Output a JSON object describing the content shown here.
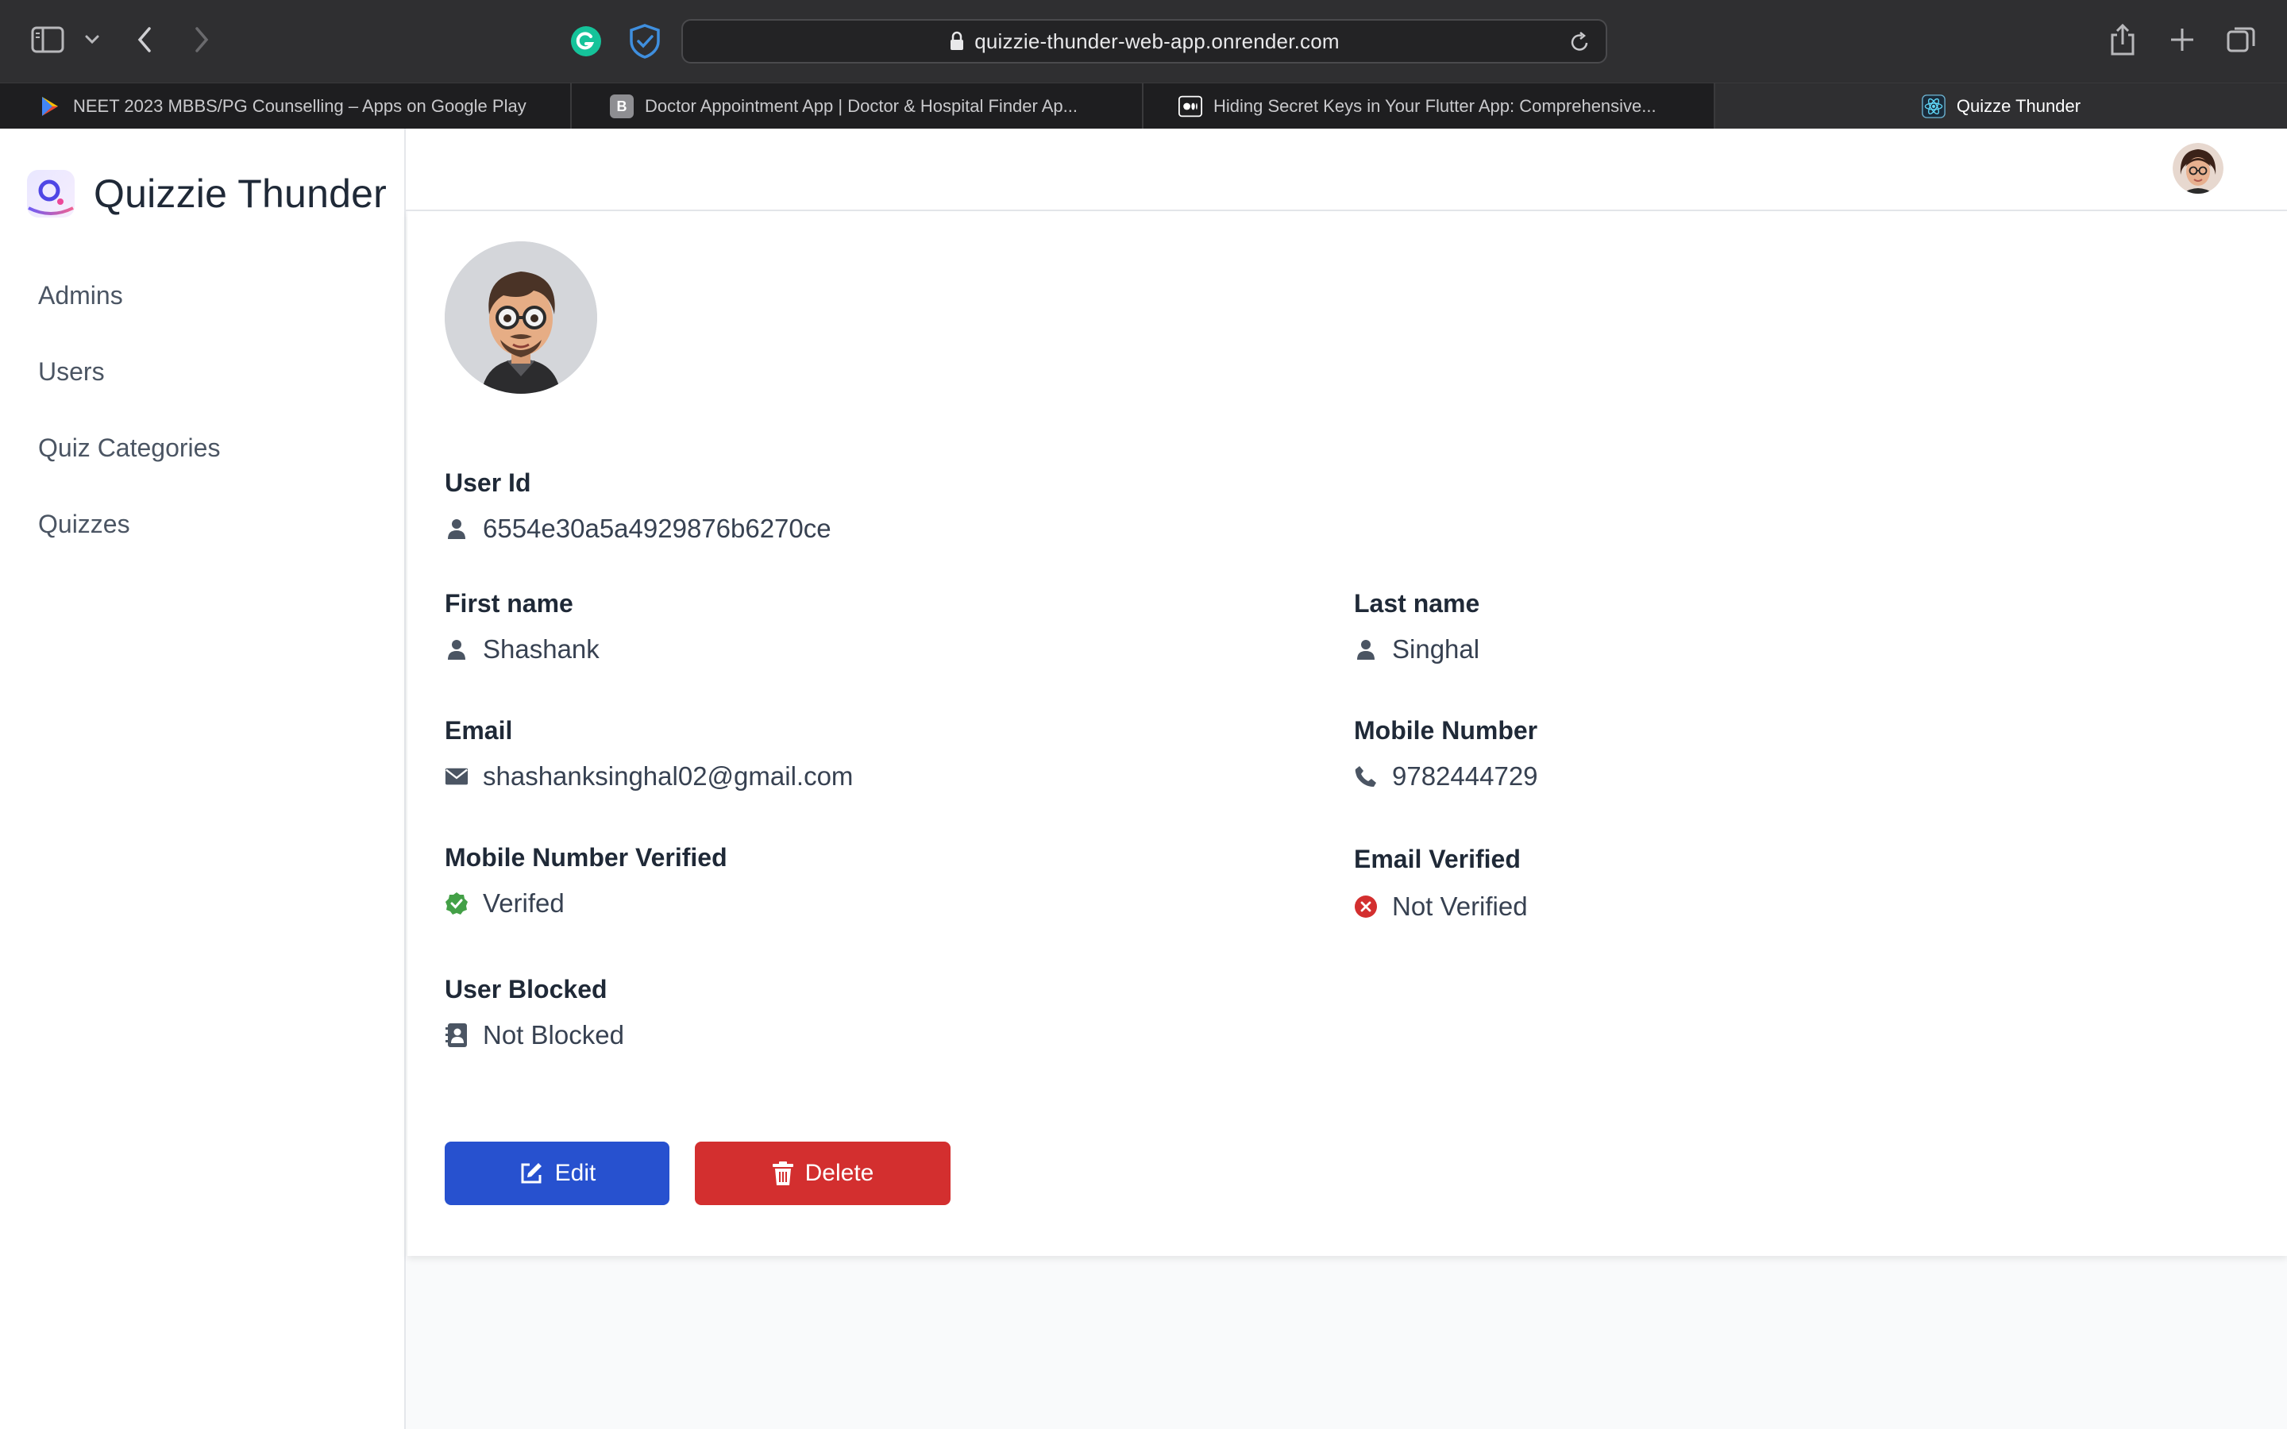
{
  "browser": {
    "url": "quizzie-thunder-web-app.onrender.com",
    "tabs": [
      {
        "title": "NEET 2023 MBBS/PG Counselling – Apps on Google Play",
        "icon": "google-play-icon"
      },
      {
        "title": "Doctor Appointment App | Doctor & Hospital Finder Ap...",
        "icon": "b-letter-icon",
        "fav_text": "B"
      },
      {
        "title": "Hiding Secret Keys in Your Flutter App: Comprehensive...",
        "icon": "medium-icon"
      },
      {
        "title": "Quizze Thunder",
        "icon": "react-icon",
        "active": true
      }
    ]
  },
  "app": {
    "brand": "Quizzie Thunder",
    "nav": [
      "Admins",
      "Users",
      "Quiz Categories",
      "Quizzes"
    ]
  },
  "user": {
    "user_id_label": "User Id",
    "user_id": "6554e30a5a4929876b6270ce",
    "first_name_label": "First name",
    "first_name": "Shashank",
    "last_name_label": "Last name",
    "last_name": "Singhal",
    "email_label": "Email",
    "email": "shashanksinghal02@gmail.com",
    "mobile_label": "Mobile Number",
    "mobile": "9782444729",
    "mobile_verified_label": "Mobile Number Verified",
    "mobile_verified": "Verifed",
    "email_verified_label": "Email Verified",
    "email_verified": "Not Verified",
    "blocked_label": "User Blocked",
    "blocked": "Not Blocked"
  },
  "actions": {
    "edit": "Edit",
    "delete": "Delete"
  },
  "colors": {
    "edit_button": "#2751cf",
    "delete_button": "#d32f2f",
    "verified": "#16a34a",
    "not_verified": "#dc2626"
  }
}
